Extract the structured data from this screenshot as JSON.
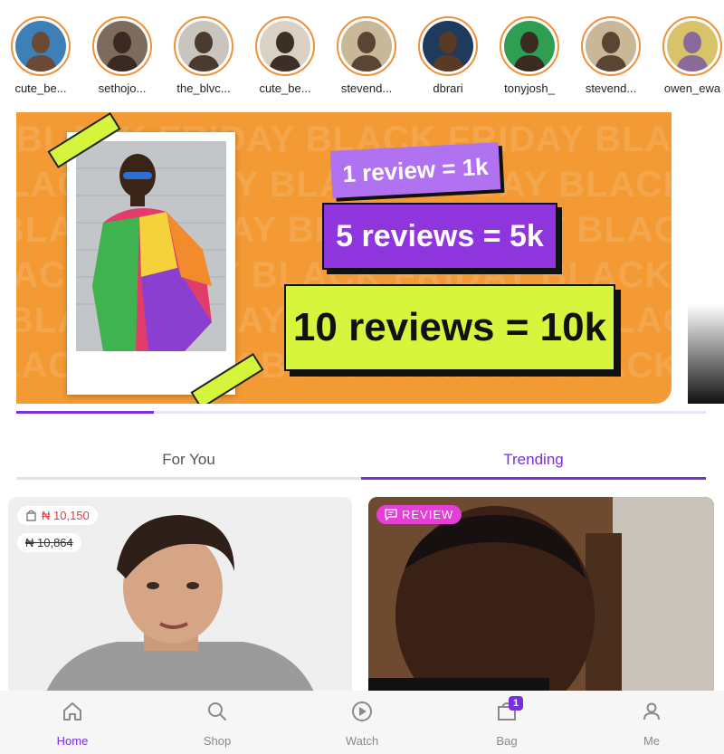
{
  "stories": [
    {
      "name": "cute_be...",
      "bg": "#3e7fb8",
      "fg": "#6b4a33"
    },
    {
      "name": "sethojo...",
      "bg": "#7d6b5e",
      "fg": "#3b2a22"
    },
    {
      "name": "the_blvc...",
      "bg": "#c9c4bd",
      "fg": "#4a3a30"
    },
    {
      "name": "cute_be...",
      "bg": "#d9d1c4",
      "fg": "#3d2e26"
    },
    {
      "name": "stevend...",
      "bg": "#c8b898",
      "fg": "#5a4434"
    },
    {
      "name": "dbrari",
      "bg": "#1f3a5a",
      "fg": "#5a3a22"
    },
    {
      "name": "tonyjosh_",
      "bg": "#2e9e52",
      "fg": "#3a2a20"
    },
    {
      "name": "stevend...",
      "bg": "#c8b898",
      "fg": "#5a4434"
    },
    {
      "name": "owen_ewa",
      "bg": "#d8c26a",
      "fg": "#8a6a9a"
    }
  ],
  "banner": {
    "background_text": "BLACK FRIDAY BLACK FRIDAY BLACK FRIDAY",
    "badge_1": "1 review = 1k",
    "badge_2": "5 reviews = 5k",
    "badge_3": "10 reviews = 10k",
    "slide_progress": 0.2
  },
  "tabs": [
    {
      "label": "For You",
      "active": false
    },
    {
      "label": "Trending",
      "active": true
    }
  ],
  "cards": {
    "product_price": "₦ 10,150",
    "product_old_price": "₦ 10,864",
    "review_label": "REVIEW"
  },
  "nav": {
    "home": "Home",
    "shop": "Shop",
    "watch": "Watch",
    "bag": "Bag",
    "bag_count": "1",
    "me": "Me"
  },
  "colors": {
    "accent": "#7b2fd9",
    "story_ring": "#f0913a",
    "banner_orange": "#f39a34",
    "lime": "#d6f53c",
    "price_red": "#e23b3b",
    "review_pink": "#e63fd8"
  }
}
